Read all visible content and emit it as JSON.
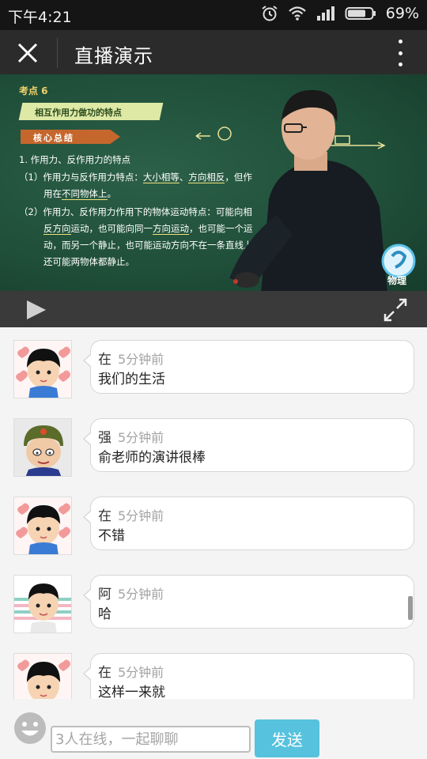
{
  "status_bar": {
    "time": "下午4:21",
    "battery": "69%"
  },
  "header": {
    "title": "直播演示"
  },
  "video": {
    "kaodian": "考点 6",
    "topic": "相互作用力做功的特点",
    "core": "核心总结",
    "line1": "1. 作用力、反作用力的特点",
    "line2a": "（1）作用力与反作用力特点：",
    "line2b": "大小相等",
    "line2c": "、",
    "line2d": "方向相反",
    "line2e": "，但作",
    "line3a": "用在",
    "line3b": "不同物体上",
    "line3c": "。",
    "line4": "（2）作用力、反作用力作用下的物体运动特点：可能向相",
    "line5a": "反方向",
    "line5b": "运动，也可能向同一",
    "line5c": "方向运动",
    "line5d": "，也可能一个运",
    "line6": "动，而另一个静止，也可能运动方向不在一条直线上",
    "line7": "还可能两物体都静止。",
    "logo_text": "物理"
  },
  "messages": [
    {
      "user": "在",
      "time": "5分钟前",
      "text": "我们的生活"
    },
    {
      "user": "强",
      "time": "5分钟前",
      "text": "俞老师的演讲很棒"
    },
    {
      "user": "在",
      "time": "5分钟前",
      "text": "不错"
    },
    {
      "user": "阿",
      "time": "5分钟前",
      "text": "哈"
    },
    {
      "user": "在",
      "time": "5分钟前",
      "text": "这样一来就"
    }
  ],
  "input": {
    "placeholder": "3人在线，一起聊聊"
  },
  "send_label": "发送"
}
